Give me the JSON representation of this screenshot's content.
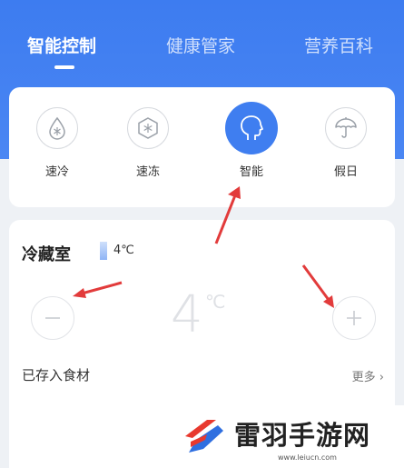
{
  "tabs": [
    {
      "label": "智能控制",
      "active": true
    },
    {
      "label": "健康管家",
      "active": false
    },
    {
      "label": "营养百科",
      "active": false
    }
  ],
  "modes": [
    {
      "label": "速冷",
      "icon": "snowflake-drop-icon",
      "active": false
    },
    {
      "label": "速冻",
      "icon": "snowflake-hexagon-icon",
      "active": false
    },
    {
      "label": "智能",
      "icon": "head-profile-icon",
      "active": true
    },
    {
      "label": "假日",
      "icon": "umbrella-icon",
      "active": false
    }
  ],
  "fridge": {
    "title": "冷藏室",
    "current_temp": "4℃",
    "display_value": "4",
    "display_unit": "℃",
    "stored_title": "已存入食材",
    "more_label": "更多"
  },
  "watermark": {
    "title": "雷羽手游网",
    "url": "www.leiucn.com"
  },
  "colors": {
    "accent": "#3f7ef0",
    "annotation_arrow": "#e23b3b",
    "watermark_red": "#e8392e",
    "watermark_blue": "#2f6fe0"
  }
}
